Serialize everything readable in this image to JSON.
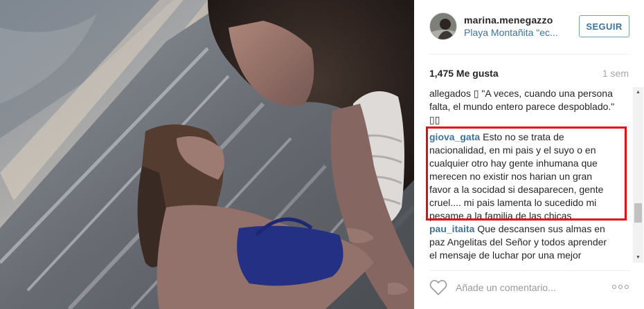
{
  "post": {
    "username": "marina.menegazzo",
    "location": "Playa Montañita \"ec...",
    "follow_label": "SEGUIR",
    "likes": "1,475 Me gusta",
    "time_ago": "1 sem"
  },
  "comments": [
    {
      "user": "",
      "text": "allegados ▯ \"A veces, cuando una persona falta, el mundo entero parece despoblado.\" ▯▯"
    },
    {
      "user": "giova_gata",
      "text": "Esto no se trata de nacionalidad, en mi pais y el suyo o en cualquier otro hay gente inhumana que merecen no existir nos harian un gran favor a la socidad si desaparecen, gente cruel.... mi pais lamenta lo sucedido mi pesame a la familia de las chicas"
    },
    {
      "user": "pau_itaita",
      "text": "Que descansen sus almas en paz Angelitas del Señor y todos aprender el mensaje de luchar por una mejor humanidad"
    }
  ],
  "input": {
    "placeholder": "Añade un comentario..."
  },
  "colors": {
    "link": "#3f729b",
    "highlight": "#e8090e",
    "text": "#262626",
    "muted": "#a5a7aa"
  },
  "icons": {
    "heart": "heart-icon",
    "more": "more-options-icon"
  }
}
